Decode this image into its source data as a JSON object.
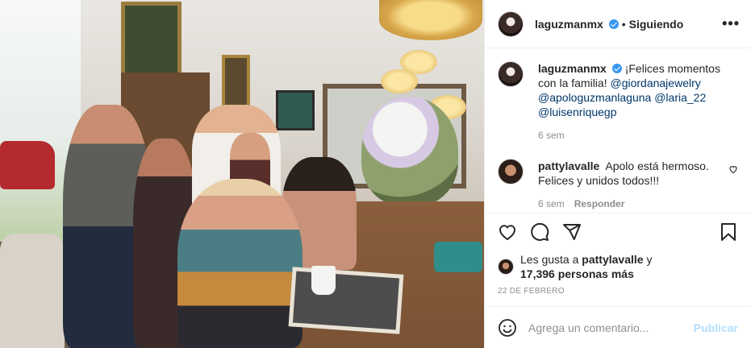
{
  "post": {
    "photo_alt": "",
    "header": {
      "username": "laguzmanmx",
      "follow_status": "Siguiendo",
      "more_label": "•••"
    },
    "caption": {
      "username": "laguzmanmx",
      "text": "¡Felices momentos con la familia!",
      "tags": [
        "@giordanajewelry",
        "@apologuzmanlaguna",
        "@laria_22",
        "@luisenriquegp"
      ],
      "time": "6 sem"
    },
    "comments": [
      {
        "username": "pattylavalle",
        "text": "Apolo está hermoso. Felices y unidos todos!!!",
        "time": "6 sem",
        "reply_label": "Responder"
      }
    ],
    "likes": {
      "prefix": "Les gusta a",
      "user": "pattylavalle",
      "conj": "y",
      "others": "17,396 personas más"
    },
    "date": "22 DE FEBRERO",
    "add_comment": {
      "placeholder": "Agrega un comentario...",
      "post_label": "Publicar"
    }
  },
  "icons": [
    "verified-icon",
    "more-options-icon",
    "heart-icon",
    "comment-icon",
    "share-icon",
    "save-icon",
    "emoji-icon"
  ],
  "colors": {
    "link": "#00376b",
    "verified": "#3897f0",
    "post_button": "#b2dffc",
    "muted": "#8e8e8e"
  }
}
